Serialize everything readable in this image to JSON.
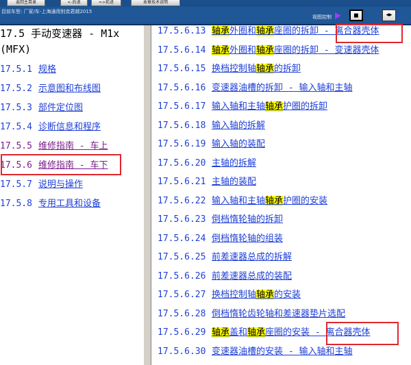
{
  "toolbar": {
    "buttons": [
      "返回主目录",
      "<-后退",
      "=>前进",
      "本章技术说明"
    ]
  },
  "nav": {
    "breadcrumb": "目前车型: 厂家/车-上海通用别克君越2015",
    "toc_label": "视图控制",
    "toc_button": "◼",
    "split_button": "◂▸"
  },
  "left": {
    "title": "17.5 手动变速器 - M1x (MFX)",
    "items": [
      {
        "num": "17.5.1",
        "label": "规格"
      },
      {
        "num": "17.5.2",
        "label": "示意图和布线图"
      },
      {
        "num": "17.5.3",
        "label": "部件定位图"
      },
      {
        "num": "17.5.4",
        "label": "诊断信息和程序"
      },
      {
        "num": "17.5.5",
        "label": "维修指南 - 车上"
      },
      {
        "num": "17.5.6",
        "label": "维修指南 - 车下"
      },
      {
        "num": "17.5.7",
        "label": "说明与操作"
      },
      {
        "num": "17.5.8",
        "label": "专用工具和设备"
      }
    ]
  },
  "right": {
    "items": [
      {
        "num": "17.5.6.13",
        "parts": [
          {
            "t": "轴承",
            "h": true
          },
          {
            "t": "外圈和",
            "h": false
          },
          {
            "t": "轴承",
            "h": true
          },
          {
            "t": "座圈的拆卸 - 离合器壳体",
            "h": false
          }
        ]
      },
      {
        "num": "17.5.6.14",
        "parts": [
          {
            "t": "轴承",
            "h": true
          },
          {
            "t": "外圈和",
            "h": false
          },
          {
            "t": "轴承",
            "h": true
          },
          {
            "t": "座圈的拆卸 - 变速器壳体",
            "h": false
          }
        ]
      },
      {
        "num": "17.5.6.15",
        "parts": [
          {
            "t": "换档控制轴",
            "h": false
          },
          {
            "t": "轴承",
            "h": true
          },
          {
            "t": "的拆卸",
            "h": false
          }
        ]
      },
      {
        "num": "17.5.6.16",
        "parts": [
          {
            "t": "变速器油槽的拆卸 - 输入轴和主轴",
            "h": false
          }
        ]
      },
      {
        "num": "17.5.6.17",
        "parts": [
          {
            "t": "输入轴和主轴",
            "h": false
          },
          {
            "t": "轴承",
            "h": true
          },
          {
            "t": "护圈的拆卸",
            "h": false
          }
        ]
      },
      {
        "num": "17.5.6.18",
        "parts": [
          {
            "t": "输入轴的拆解",
            "h": false
          }
        ]
      },
      {
        "num": "17.5.6.19",
        "parts": [
          {
            "t": "输入轴的装配",
            "h": false
          }
        ]
      },
      {
        "num": "17.5.6.20",
        "parts": [
          {
            "t": "主轴的拆解",
            "h": false
          }
        ]
      },
      {
        "num": "17.5.6.21",
        "parts": [
          {
            "t": "主轴的装配",
            "h": false
          }
        ]
      },
      {
        "num": "17.5.6.22",
        "parts": [
          {
            "t": "输入轴和主轴",
            "h": false
          },
          {
            "t": "轴承",
            "h": true
          },
          {
            "t": "护圈的安装",
            "h": false
          }
        ]
      },
      {
        "num": "17.5.6.23",
        "parts": [
          {
            "t": "倒档惰轮轴的拆卸",
            "h": false
          }
        ]
      },
      {
        "num": "17.5.6.24",
        "parts": [
          {
            "t": "倒档惰轮轴的组装",
            "h": false
          }
        ]
      },
      {
        "num": "17.5.6.25",
        "parts": [
          {
            "t": "前差速器总成的拆解",
            "h": false
          }
        ]
      },
      {
        "num": "17.5.6.26",
        "parts": [
          {
            "t": "前差速器总成的装配",
            "h": false
          }
        ]
      },
      {
        "num": "17.5.6.27",
        "parts": [
          {
            "t": "换档控制轴",
            "h": false
          },
          {
            "t": "轴承",
            "h": true
          },
          {
            "t": "的安装",
            "h": false
          }
        ]
      },
      {
        "num": "17.5.6.28",
        "parts": [
          {
            "t": "倒档惰轮齿轮轴和差速器垫片选配",
            "h": false
          }
        ]
      },
      {
        "num": "17.5.6.29",
        "parts": [
          {
            "t": "轴承",
            "h": true
          },
          {
            "t": "盖和",
            "h": false
          },
          {
            "t": "轴承",
            "h": true
          },
          {
            "t": "座圈的安装 - 离合器壳体",
            "h": false
          }
        ]
      },
      {
        "num": "17.5.6.30",
        "parts": [
          {
            "t": "变速器油槽的安装 - 输入轴和主轴",
            "h": false
          }
        ]
      }
    ]
  },
  "colors": {
    "link": "#1e3fd6",
    "visited": "#7a1b8a",
    "highlight": "#ffff00",
    "annotation_box": "#e0262b"
  }
}
